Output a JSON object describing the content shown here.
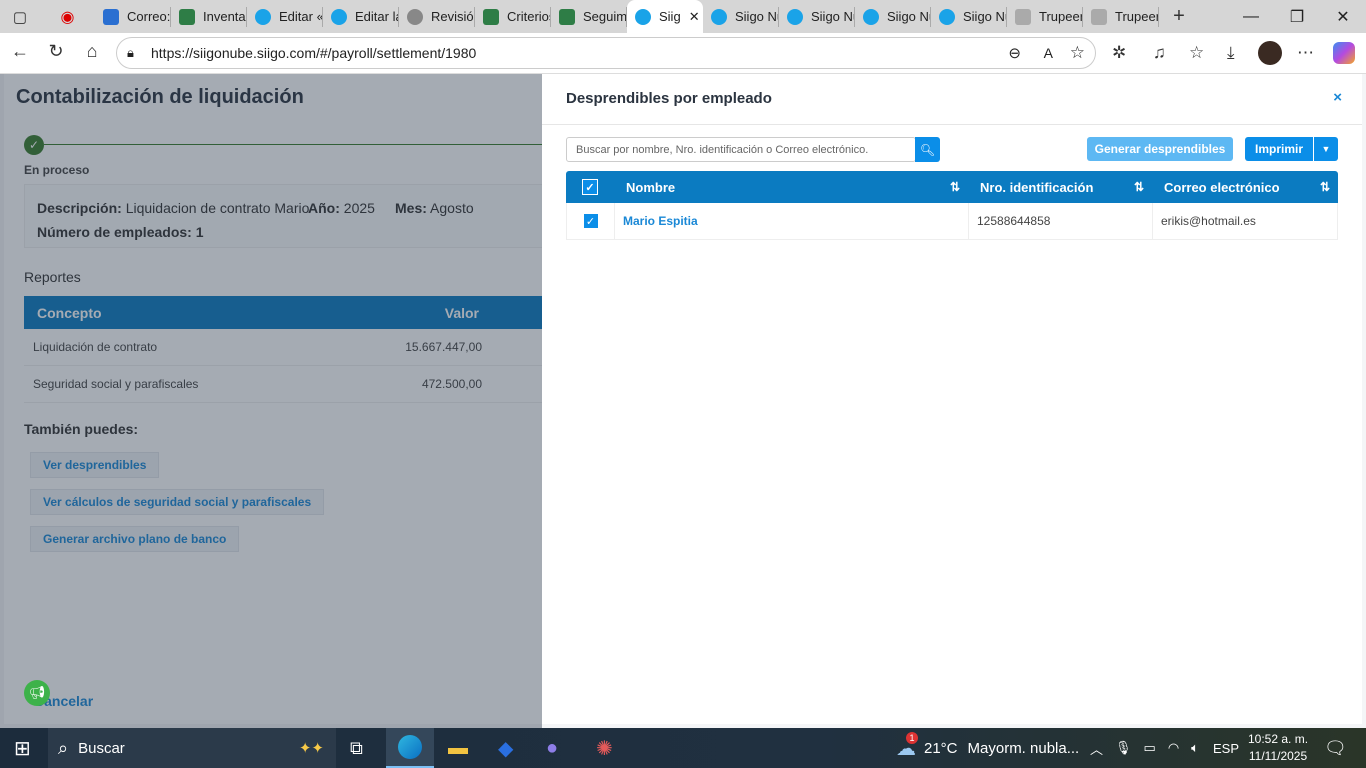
{
  "browser": {
    "tabs": [
      {
        "label": "Correo:",
        "icon": "outlook"
      },
      {
        "label": "Inventar",
        "icon": "excel"
      },
      {
        "label": "Editar «",
        "icon": "siigo"
      },
      {
        "label": "Editar la",
        "icon": "siigo"
      },
      {
        "label": "Revisión",
        "icon": "chatgpt"
      },
      {
        "label": "Criterios",
        "icon": "excel"
      },
      {
        "label": "Seguimi",
        "icon": "excel"
      },
      {
        "label": "Siig",
        "icon": "siigo",
        "active": true
      },
      {
        "label": "Siigo Nu",
        "icon": "siigo"
      },
      {
        "label": "Siigo Nu",
        "icon": "siigo"
      },
      {
        "label": "Siigo Nu",
        "icon": "siigo"
      },
      {
        "label": "Siigo Nu",
        "icon": "siigo"
      },
      {
        "label": "Trupeer",
        "icon": "trupeer"
      },
      {
        "label": "Trupeer",
        "icon": "trupeer"
      }
    ],
    "url": "https://siigonube.siigo.com/#/payroll/settlement/1980"
  },
  "page": {
    "title": "Contabilización de liquidación",
    "step_label": "En proceso",
    "info": {
      "desc_label": "Descripción:",
      "desc_value": "Liquidacion de contrato Mario",
      "year_label": "Año:",
      "year_value": "2025",
      "month_label": "Mes:",
      "month_value": "Agosto",
      "employees_label": "Número de empleados:",
      "employees_value": "1"
    },
    "reports_title": "Reportes",
    "reports_table": {
      "headers": [
        "Concepto",
        "Valor"
      ],
      "rows": [
        [
          "Liquidación de contrato",
          "15.667.447,00"
        ],
        [
          "Seguridad social y parafiscales",
          "472.500,00"
        ]
      ]
    },
    "also_title": "También puedes:",
    "links": [
      "Ver desprendibles",
      "Ver cálculos de seguridad social y parafiscales",
      "Generar archivo plano de banco"
    ],
    "cancel": "Cancelar"
  },
  "drawer": {
    "title": "Desprendibles por empleado",
    "close": "×",
    "search_placeholder": "Buscar por nombre, Nro. identificación o Correo electrónico.",
    "generate": "Generar desprendibles",
    "print": "Imprimir",
    "headers": [
      "Nombre",
      "Nro. identificación",
      "Correo electrónico"
    ],
    "rows": [
      {
        "name": "Mario Espitia",
        "id": "12588644858",
        "email": "erikis@hotmail.es",
        "checked": true
      }
    ]
  },
  "taskbar": {
    "search": "Buscar",
    "weather_temp": "21°C",
    "weather_desc": "Mayorm. nubla...",
    "weather_badge": "1",
    "lang": "ESP",
    "time": "10:52 a. m.",
    "date": "11/11/2025"
  },
  "colors": {
    "primary": "#0b8ee8",
    "header": "#0b7bc1",
    "success": "#3a7d2c",
    "generate_disabled": "#5db8f3"
  }
}
